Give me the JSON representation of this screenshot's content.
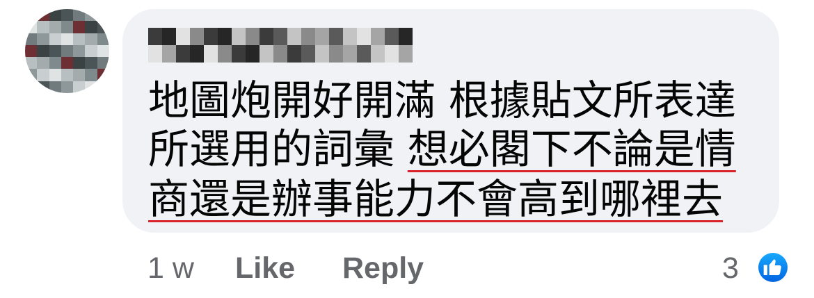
{
  "comment": {
    "author_name_redacted": true,
    "text_lines": [
      {
        "segments": [
          {
            "text": "地圖炮開好開滿 根據貼文所表達",
            "underline": false
          }
        ]
      },
      {
        "segments": [
          {
            "text": "所選用的詞彙 ",
            "underline": false
          },
          {
            "text": "想必閣下不論是情",
            "underline": true
          }
        ]
      },
      {
        "segments": [
          {
            "text": "商還是辦事能力不會高到哪裡去",
            "underline": true
          }
        ]
      }
    ]
  },
  "line1_a": "地圖炮開好開滿 根據貼文所表達",
  "line2_a": "所選用的詞彙 ",
  "line2_b": "想必閣下不論是情",
  "line3_a": "商還是辦事能力不會高到哪裡去",
  "actions": {
    "timestamp": "1 w",
    "like_label": "Like",
    "reply_label": "Reply",
    "reaction_count": "3",
    "reaction_icon": "thumbs-up-icon"
  },
  "colors": {
    "bubble": "#f0f2f5",
    "text": "#050505",
    "meta": "#65676b",
    "underline": "#d8232a",
    "like_blue": "#0866ff"
  }
}
